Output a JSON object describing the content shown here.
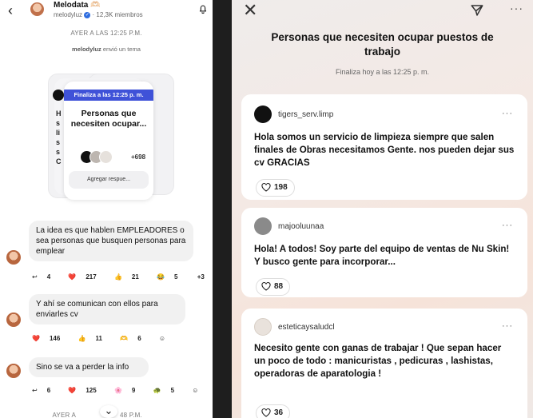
{
  "chat": {
    "title": "Melodata",
    "title_emoji": "🫶🏻",
    "handle": "melodyluz",
    "members": "12,3K miembros",
    "timestamp_1": "AYER A LAS 12:25 P.M.",
    "system_user": "melodyluz",
    "system_action": "envió un tema",
    "poll": {
      "badge": "Finaliza a las 12:25 p. m.",
      "title": "Personas que necesiten ocupar...",
      "count": "+698",
      "button": "Agregar respue..."
    },
    "poll_back_text": "H\ns\nli\ns\ns\nC",
    "messages": [
      {
        "text": "La idea es que hablen EMPLEADORES o sea personas que busquen personas para emplear",
        "reactions": [
          {
            "icon": "reply-icon",
            "glyph": "↩",
            "value": "4"
          },
          {
            "icon": "heart-icon",
            "glyph": "❤️",
            "value": "217"
          },
          {
            "icon": "thumbs-up-icon",
            "glyph": "👍",
            "value": "21"
          },
          {
            "icon": "laugh-icon",
            "glyph": "😂",
            "value": "5"
          },
          {
            "icon": "more-reactions",
            "glyph": "",
            "value": "+3"
          }
        ]
      },
      {
        "text": "Y ahí se comunican con ellos para enviarles cv",
        "reactions": [
          {
            "icon": "heart-icon",
            "glyph": "❤️",
            "value": "146"
          },
          {
            "icon": "thumbs-up-icon",
            "glyph": "👍",
            "value": "11"
          },
          {
            "icon": "smile-eyes-icon",
            "glyph": "🫶",
            "value": "6"
          },
          {
            "icon": "add-reaction-icon",
            "glyph": "☺",
            "value": ""
          }
        ]
      },
      {
        "text": "Sino se va a perder la info",
        "reactions": [
          {
            "icon": "reply-icon",
            "glyph": "↩",
            "value": "6"
          },
          {
            "icon": "heart-icon",
            "glyph": "❤️",
            "value": "125"
          },
          {
            "icon": "flower-icon",
            "glyph": "🌸",
            "value": "9"
          },
          {
            "icon": "turtle-icon",
            "glyph": "🐢",
            "value": "5"
          },
          {
            "icon": "add-reaction-icon",
            "glyph": "☺",
            "value": ""
          }
        ]
      }
    ],
    "timestamp_2_a": "AYER A",
    "timestamp_2_b": "48 P.M."
  },
  "thread": {
    "title": "Personas que necesiten ocupar puestos de trabajo",
    "subtitle": "Finaliza hoy a las 12:25 p. m.",
    "responses": [
      {
        "user": "tigers_serv.limp",
        "text": "Hola somos un servicio de limpieza siempre que salen finales de Obras necesitamos Gente. nos pueden dejar sus cv GRACIAS",
        "likes": "198",
        "avatar_color": "#111111"
      },
      {
        "user": "majooluunaa",
        "text": "Hola! A todos! Soy parte del equipo de ventas de Nu Skin! Y busco gente para incorporar...",
        "likes": "88",
        "avatar_color": "#8a8a8a"
      },
      {
        "user": "esteticaysaludcl",
        "text": "Necesito gente con ganas de trabajar ! Que sepan hacer un poco de todo : manicuristas , pedicuras , lashistas, operadoras de aparatologia !",
        "likes": "36",
        "avatar_color": "#e9e2dc"
      }
    ]
  }
}
